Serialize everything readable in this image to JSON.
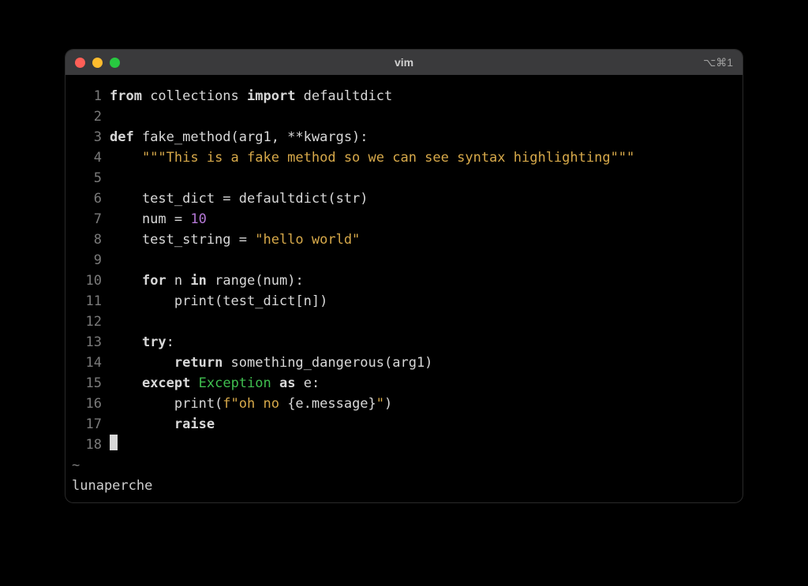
{
  "window": {
    "title": "vim",
    "right_indicator": "⌥⌘1"
  },
  "editor": {
    "lines": [
      {
        "n": 1,
        "tokens": [
          {
            "t": "from",
            "c": "kw"
          },
          {
            "t": " collections ",
            "c": "plain"
          },
          {
            "t": "import",
            "c": "kw"
          },
          {
            "t": " defaultdict",
            "c": "plain"
          }
        ]
      },
      {
        "n": 2,
        "tokens": []
      },
      {
        "n": 3,
        "tokens": [
          {
            "t": "def",
            "c": "kw"
          },
          {
            "t": " fake_method(arg1, **kwargs):",
            "c": "plain"
          }
        ]
      },
      {
        "n": 4,
        "tokens": [
          {
            "t": "    ",
            "c": "plain"
          },
          {
            "t": "\"\"\"This is a fake method so we can see syntax highlighting\"\"\"",
            "c": "str"
          }
        ]
      },
      {
        "n": 5,
        "tokens": []
      },
      {
        "n": 6,
        "tokens": [
          {
            "t": "    test_dict = defaultdict(str)",
            "c": "plain"
          }
        ]
      },
      {
        "n": 7,
        "tokens": [
          {
            "t": "    num = ",
            "c": "plain"
          },
          {
            "t": "10",
            "c": "num"
          }
        ]
      },
      {
        "n": 8,
        "tokens": [
          {
            "t": "    test_string = ",
            "c": "plain"
          },
          {
            "t": "\"hello world\"",
            "c": "str"
          }
        ]
      },
      {
        "n": 9,
        "tokens": []
      },
      {
        "n": 10,
        "tokens": [
          {
            "t": "    ",
            "c": "plain"
          },
          {
            "t": "for",
            "c": "kw"
          },
          {
            "t": " n ",
            "c": "plain"
          },
          {
            "t": "in",
            "c": "kw"
          },
          {
            "t": " range(num):",
            "c": "plain"
          }
        ]
      },
      {
        "n": 11,
        "tokens": [
          {
            "t": "        print(test_dict[n])",
            "c": "plain"
          }
        ]
      },
      {
        "n": 12,
        "tokens": []
      },
      {
        "n": 13,
        "tokens": [
          {
            "t": "    ",
            "c": "plain"
          },
          {
            "t": "try",
            "c": "kw"
          },
          {
            "t": ":",
            "c": "plain"
          }
        ]
      },
      {
        "n": 14,
        "tokens": [
          {
            "t": "        ",
            "c": "plain"
          },
          {
            "t": "return",
            "c": "kw"
          },
          {
            "t": " something_dangerous(arg1)",
            "c": "plain"
          }
        ]
      },
      {
        "n": 15,
        "tokens": [
          {
            "t": "    ",
            "c": "plain"
          },
          {
            "t": "except",
            "c": "kw"
          },
          {
            "t": " ",
            "c": "plain"
          },
          {
            "t": "Exception",
            "c": "exc"
          },
          {
            "t": " ",
            "c": "plain"
          },
          {
            "t": "as",
            "c": "kw"
          },
          {
            "t": " e:",
            "c": "plain"
          }
        ]
      },
      {
        "n": 16,
        "tokens": [
          {
            "t": "        print(",
            "c": "plain"
          },
          {
            "t": "f\"oh no ",
            "c": "str"
          },
          {
            "t": "{e.message}",
            "c": "plain"
          },
          {
            "t": "\"",
            "c": "str"
          },
          {
            "t": ")",
            "c": "plain"
          }
        ]
      },
      {
        "n": 17,
        "tokens": [
          {
            "t": "        ",
            "c": "plain"
          },
          {
            "t": "raise",
            "c": "kw"
          }
        ]
      },
      {
        "n": 18,
        "tokens": [
          {
            "t": "",
            "c": "plain",
            "cursor": true
          }
        ]
      }
    ],
    "tilde": "~",
    "status": "lunaperche"
  }
}
